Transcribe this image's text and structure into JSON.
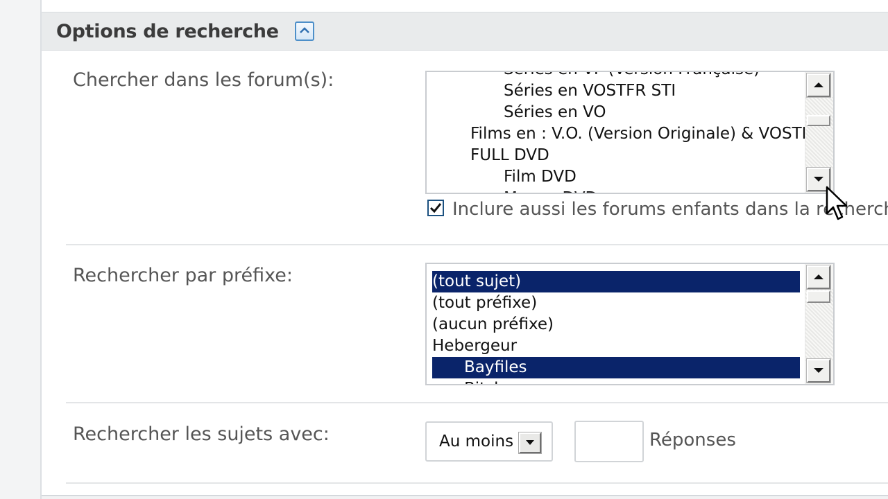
{
  "section": {
    "title": "Options de recherche"
  },
  "forums": {
    "label": "Chercher dans les forum(s):",
    "options": [
      {
        "text": "Séries en VF (Version Française)",
        "level": 2,
        "selected": false
      },
      {
        "text": "Séries en VOSTFR STI",
        "level": 2,
        "selected": false
      },
      {
        "text": "Séries en VO",
        "level": 2,
        "selected": false
      },
      {
        "text": "Films en : V.O. (Version Originale) & VOSTFR",
        "level": 1,
        "selected": false
      },
      {
        "text": "FULL DVD",
        "level": 1,
        "selected": false
      },
      {
        "text": "Film DVD",
        "level": 2,
        "selected": false
      },
      {
        "text": "Manga DVD",
        "level": 2,
        "selected": false
      }
    ],
    "include_children_checked": true,
    "include_children_label": "Inclure aussi les forums enfants dans la recherche"
  },
  "prefix": {
    "label": "Rechercher par préfixe:",
    "options": [
      {
        "text": "(tout sujet)",
        "level": 0,
        "selected": true
      },
      {
        "text": "(tout préfixe)",
        "level": 0,
        "selected": false
      },
      {
        "text": "(aucun préfixe)",
        "level": 0,
        "selected": false
      },
      {
        "text": "Hebergeur",
        "level": 0,
        "selected": false
      },
      {
        "text": "Bayfiles",
        "level": 1,
        "selected": true
      },
      {
        "text": "Bitshare",
        "level": 1,
        "selected": false
      }
    ]
  },
  "replies": {
    "label": "Rechercher les sujets avec:",
    "mode_selected": "Au moins",
    "count_value": "",
    "suffix": "Réponses"
  },
  "icons": {
    "collapse": "collapse-up-icon",
    "scroll_up": "arrow-up-icon",
    "scroll_down": "arrow-down-icon",
    "checkbox": "checkmark-icon",
    "dropdown": "chevron-down-icon",
    "cursor": "mouse-pointer-icon"
  },
  "colors": {
    "selection": "#0a246a",
    "accent": "#4d8fc9",
    "header_bg": "#e9ebec"
  }
}
